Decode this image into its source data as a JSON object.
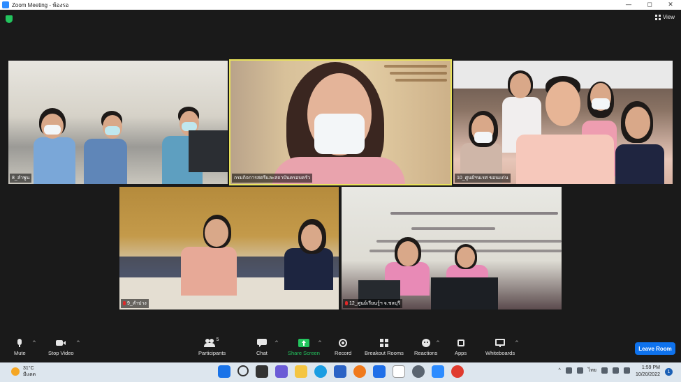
{
  "window": {
    "title": "Zoom Meeting - ห้องรอ"
  },
  "view": {
    "label": "View"
  },
  "tiles": [
    {
      "label": "8_ลำพูน"
    },
    {
      "label": "กรมกิจการสตรีและสถาบันครอบครัว"
    },
    {
      "label": "10_ศูนย์ฯนเรศ ขอนแก่น"
    },
    {
      "label": "9_ลำปาง"
    },
    {
      "label": "12_ศูนย์เรียนรู้ฯ จ.ชลบุรี"
    }
  ],
  "toolbar": {
    "mute": "Mute",
    "stop_video": "Stop Video",
    "participants": "Participants",
    "participants_count": "5",
    "chat": "Chat",
    "share_screen": "Share Screen",
    "record": "Record",
    "breakout_rooms": "Breakout Rooms",
    "reactions": "Reactions",
    "apps": "Apps",
    "whiteboards": "Whiteboards",
    "leave_room": "Leave Room"
  },
  "taskbar": {
    "temperature": "31°C",
    "weather_desc": "มีแดด",
    "language": "ไทย",
    "time": "1:59 PM",
    "date": "10/20/2022",
    "notifications": "1"
  },
  "colors": {
    "active_speaker": "#e8e25a",
    "share_green": "#23c45e",
    "leave_blue": "#0e72ed"
  }
}
